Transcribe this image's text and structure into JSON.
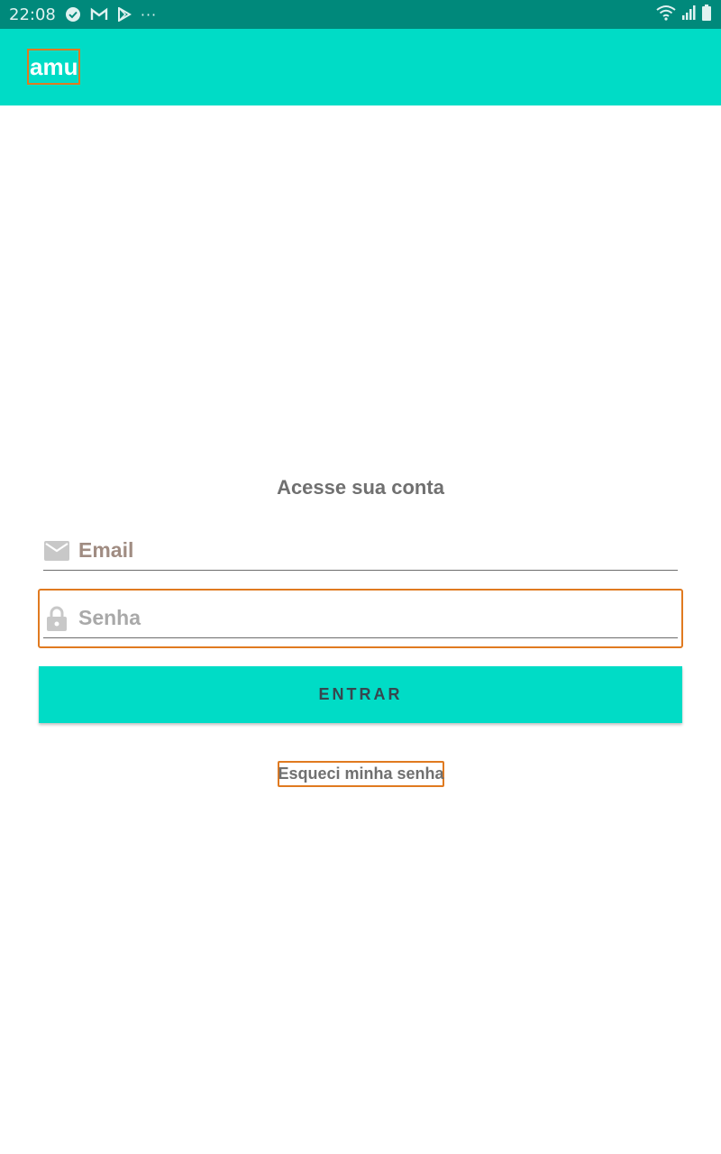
{
  "status_bar": {
    "time": "22:08",
    "more": "···",
    "icons": [
      "check-circle-icon",
      "gmail-icon",
      "play-store-icon",
      "wifi-icon",
      "signal-icon",
      "battery-icon"
    ]
  },
  "app_bar": {
    "title": "amu"
  },
  "login": {
    "heading": "Acesse sua conta",
    "email_placeholder": "Email",
    "password_placeholder": "Senha",
    "button_label": "ENTRAR",
    "forgot_link": "Esqueci minha senha"
  },
  "colors": {
    "status_bar": "#00897b",
    "accent": "#00dcc6",
    "highlight_outline": "#e07a20"
  }
}
